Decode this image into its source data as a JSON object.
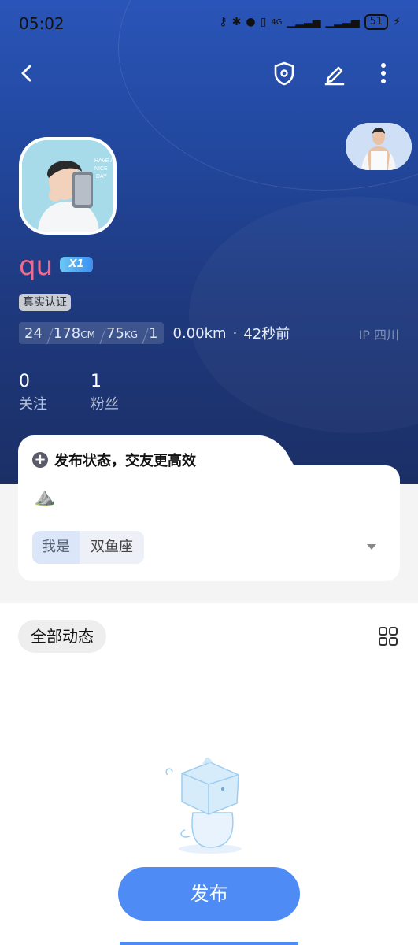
{
  "status_bar": {
    "time": "05:02",
    "battery": "51",
    "network": "4G"
  },
  "profile": {
    "name": "qu",
    "verify_badge": "真实认证",
    "stats": {
      "age": "24",
      "height": "178",
      "height_unit": "CM",
      "weight": "75",
      "weight_unit": "KG",
      "role": "1"
    },
    "distance": "0.00km",
    "time_ago": "42秒前",
    "ip": "IP 四川",
    "following": {
      "count": "0",
      "label": "关注"
    },
    "fans": {
      "count": "1",
      "label": "粉丝"
    }
  },
  "status_card": {
    "title": "发布状态，交友更高效",
    "emoji": "⛰️",
    "iam_label": "我是",
    "iam_value": "双鱼座"
  },
  "feed": {
    "tab_label": "全部动态"
  },
  "actions": {
    "publish_label": "发布"
  },
  "colors": {
    "accent": "#4e8bf5",
    "name": "#f06a8e",
    "hero_top": "#2a55b8",
    "hero_bottom": "#1b2f66"
  }
}
